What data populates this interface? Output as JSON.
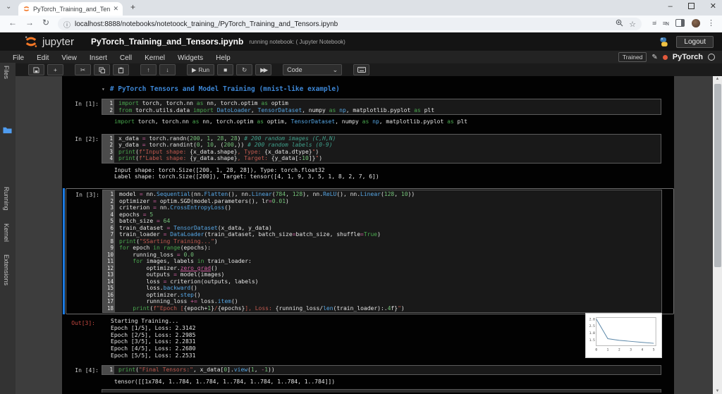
{
  "browser": {
    "tab_title": "PyTorch_Training_and_Tensors.",
    "tab_close": "✕",
    "new_tab": "+",
    "url": "localhost:8888/notebooks/notetoock_training_/PyTorch_Training_and_Tensors.ipynb",
    "minimize": "–",
    "close": "✕",
    "star": "☆",
    "kebab": "⋮",
    "back": "←",
    "forward": "→",
    "reload": "↻",
    "info": "ⓘ",
    "chevron": "⌄"
  },
  "header": {
    "logo_text": "jupyter",
    "title": "PyTorch_Training_and_Tensors.ipynb",
    "subtitle": "running notebook: ( Jupyter Notebook)",
    "logout_label": "Logout"
  },
  "menu": {
    "items": [
      "File",
      "Edit",
      "View",
      "Insert",
      "Cell",
      "Kernel",
      "Widgets",
      "Help"
    ],
    "trusted_label": "Trained",
    "kernel_name": "PyTorch",
    "kernel_dot_color": "#e2593c"
  },
  "toolbar": {
    "run_label": "Run",
    "cell_type": "Code"
  },
  "sidebar": {
    "items": [
      "Files",
      "Running",
      "Kernel",
      "Extensions"
    ]
  },
  "notebook": {
    "heading": "# PyTorch Tensors and Model Training (mnist-like example)",
    "heading_color": "#3d87d6",
    "selected_bar_color": "#1e7be0",
    "cells": [
      {
        "type": "code",
        "prompt": "In [1]:",
        "lines": [
          "import torch, torch.nn as nn, torch.optim as optim",
          "from torch.utils.data import DatoLoader, TensorDataset, numpy as np, matplotlib.pyplot as plt"
        ],
        "output": {
          "styled": true,
          "lines": [
            "import torch, torch.nn as nn, torch.optim as optim, TensorDataset, numpy as np, matplotlib.pyplot as plt"
          ]
        }
      },
      {
        "type": "code",
        "prompt": "In [2]:",
        "lines": [
          "x_data = torch.randn(200, 1, 28, 28) # 200 random images (C,H,N)",
          "y_data = torch.randint(0, 10, (200,)) # 200 random labels (0-9)",
          "print(f\"Input shape: {x_data.shape}, Type: {x_data.dtype}\")",
          "print(f\"Label shape: {y_data.shape}, Target: {y_data[:10]}\")"
        ],
        "output": {
          "styled": false,
          "lines": [
            "Input shape: torch.Size([200, 1, 28, 28]), Type: torch.float32",
            "Label shape: torch.Size([200]), Target: tensor([4, 1, 9, 3, 5, 1, 8, 2, 7, 6])"
          ]
        }
      },
      {
        "type": "code",
        "prompt": "In [3]:",
        "selected": true,
        "lines": [
          "model = nn.Sequential(nn.Flatten(), nn.Linear(784, 128), nn.ReLU(), nn.Linear(128, 10))",
          "optimizer = optim.SGD(model.parameters(), lr=0.01)",
          "criterion = nn.CrossEntropyLoss()",
          "epochs = 5",
          "batch_size = 64",
          "train_dataset = TensorDataset(x_data, y_data)",
          "train_loader = DataLoader(train_dataset, batch_size=batch_size, shuffle=True)",
          "print(\"SSarting Training...\")",
          "for epoch in range(epochs):",
          "    running_loss = 0.0",
          "    for images, labels in train_loader:",
          "        optimizer.zero_grad()",
          "        outputs = model(images)",
          "        loss = criterion(outputs, labels)",
          "        loss.backward()",
          "        optimizer.step()",
          "        running_loss += loss.item()",
          "    print(f\"Epoch [{epoch+1}/{epochs}], Loss: {running_loss/len(train_loader):.4f}\")"
        ],
        "output": {
          "prompt": "Out[3]:",
          "styled": false,
          "has_plot": true,
          "lines": [
            "Starting Training...",
            "Epoch [1/5], Loss: 2.3142",
            "Epoch [2/5], Loss: 2.2985",
            "Epoch [3/5], Loss: 2.2831",
            "Epoch [4/5], Loss: 2.2680",
            "Epoch [5/5], Loss: 2.2531"
          ]
        }
      },
      {
        "type": "code",
        "prompt": "In [4]:",
        "lines": [
          "print(\"Final Tensors:\", x_data[0].view(1, -1))"
        ],
        "output": {
          "styled": false,
          "lines": [
            "tensor([[1x784, 1..784, 1..784, 1..784, 1..784, 1..784, 1..784]])"
          ]
        }
      }
    ]
  },
  "chart_data": {
    "type": "line",
    "title": "",
    "xlabel": "",
    "ylabel": "",
    "x": [
      0,
      1,
      2,
      3,
      4,
      5
    ],
    "values": [
      2.9,
      1.58,
      1.47,
      1.4,
      1.33,
      1.27
    ],
    "xticks": [
      "0",
      "1",
      "2",
      "3",
      "4",
      "5"
    ],
    "yticks": [
      "2.8",
      "2.5",
      "1.8",
      "1.5"
    ],
    "ylim": [
      1.1,
      3.0
    ],
    "grid": false,
    "legend": "none",
    "line_color": "#5b87a8",
    "bg": "#ffffff"
  }
}
